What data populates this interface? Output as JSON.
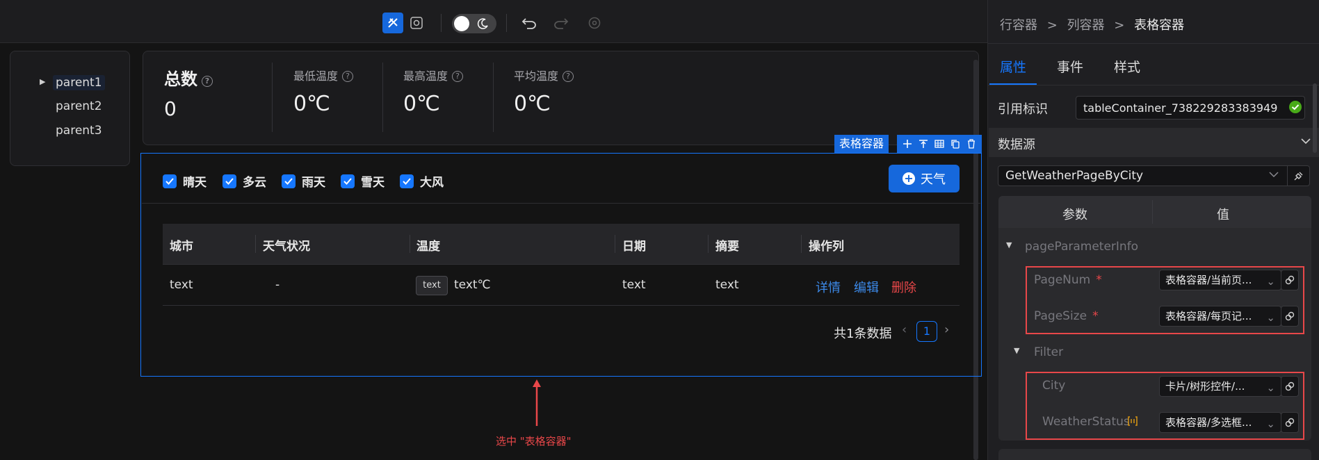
{
  "canvas": {
    "tree": {
      "items": [
        "parent1",
        "parent2",
        "parent3"
      ]
    },
    "stats": [
      {
        "title": "总数",
        "value": "0"
      },
      {
        "title": "最低温度",
        "value": "0℃"
      },
      {
        "title": "最高温度",
        "value": "0℃"
      },
      {
        "title": "平均温度",
        "value": "0℃"
      }
    ],
    "selection_label": "表格容器",
    "filters": [
      "晴天",
      "多云",
      "雨天",
      "雪天",
      "大风"
    ],
    "add_button": "天气",
    "table": {
      "columns": [
        "城市",
        "天气状况",
        "温度",
        "日期",
        "摘要",
        "操作列"
      ],
      "row": {
        "city": "text",
        "status": "-",
        "temp_tag": "text",
        "temp": "text℃",
        "date": "text",
        "summary": "text",
        "actions": [
          "详情",
          "编辑",
          "删除"
        ]
      },
      "total": "共1条数据",
      "current_page": "1"
    },
    "annotation": "选中 \"表格容器\""
  },
  "panel": {
    "breadcrumb": [
      "行容器",
      ">",
      "列容器",
      ">",
      "表格容器"
    ],
    "tabs": [
      "属性",
      "事件",
      "样式"
    ],
    "ref_label": "引用标识",
    "ref_value": "tableContainer_738229283383949",
    "datasource_label": "数据源",
    "datasource_value": "GetWeatherPageByCity",
    "params_header": [
      "参数",
      "值"
    ],
    "groups": {
      "page": "pageParameterInfo",
      "filter": "Filter"
    },
    "params": [
      {
        "name": "PageNum",
        "value": "表格容器/当前页..."
      },
      {
        "name": "PageSize",
        "value": "表格容器/每页记..."
      },
      {
        "name": "City",
        "value": "卡片/树形控件/..."
      },
      {
        "name": "WeatherStatus",
        "value": "表格容器/多选框..."
      }
    ],
    "required_mark": "*"
  },
  "colors": {
    "accent": "#1677ff",
    "danger": "#e84749",
    "bg": "#141414"
  }
}
